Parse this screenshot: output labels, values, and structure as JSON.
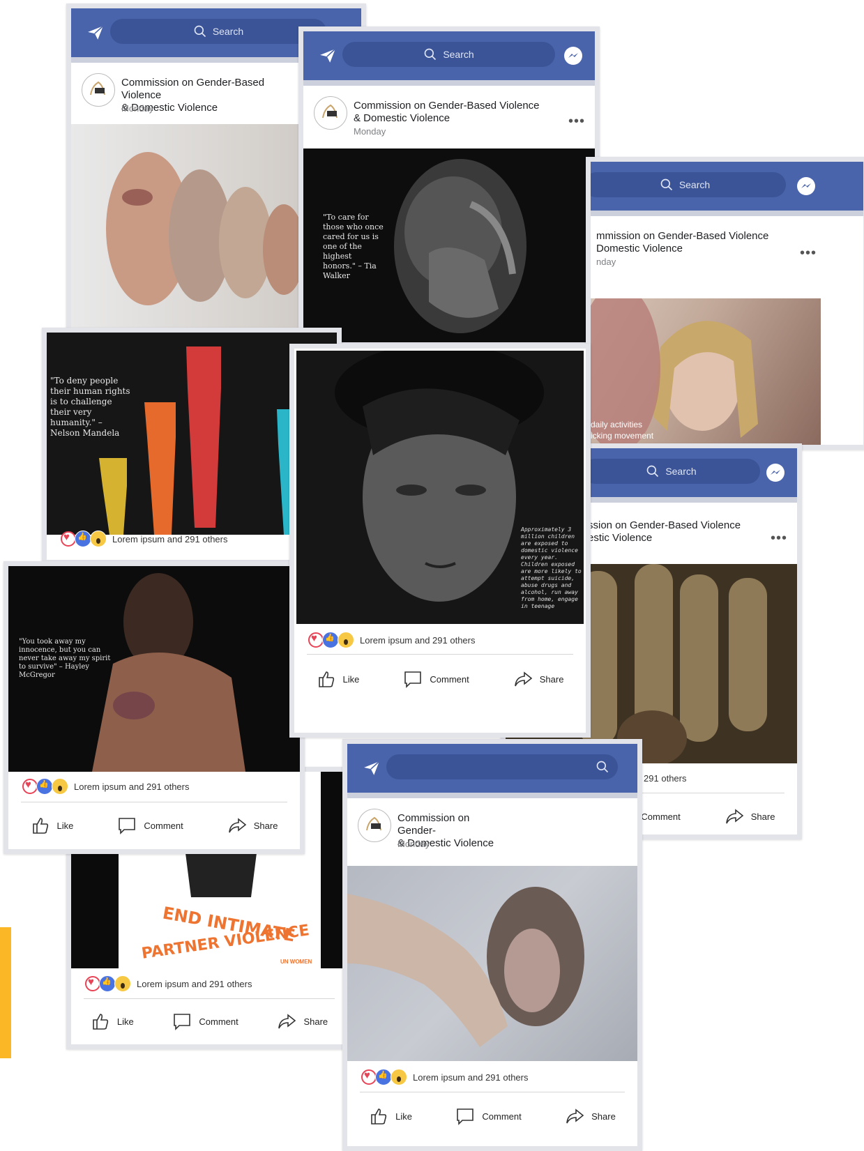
{
  "ui": {
    "search_placeholder": "Search",
    "page_name": "Commission on Gender-Based Violence & Domestic Violence",
    "page_name_line1": "Commission on Gender-Based Violence",
    "page_name_line2": "& Domestic Violence",
    "post_time": "Monday",
    "reaction_text": "Lorem ipsum and  291 others",
    "like_label": "Like",
    "comment_label": "Comment",
    "share_label": "Share",
    "more_glyph": "•••"
  },
  "colors": {
    "brand": "#4a64ab",
    "search_bg": "#3b5497",
    "accent_bar": "#fbb726",
    "heart": "#e84356",
    "like": "#4a73e2",
    "wow": "#f7c843"
  },
  "posts": {
    "mandela_quote": "\"To deny people their human rights is to challenge their very humanity.\" – Nelson Mandela",
    "walker_quote": "\"To care for those who once cared for us is one of the highest honors.\" – Tia Walker",
    "mcgregor_quote": "\"You took away my innocence, but you can never take away my spirit to survive\" – Hayley McGregor",
    "children_stat": "Approximately 3 million children are exposed to domestic violence every year. Children exposed are more likely to attempt suicide, abuse drugs and alcohol, run away from home, engage in teenage",
    "ipv_title_line1": "END INTIMATE",
    "ipv_title_line2": "PARTNER VIOLENCE",
    "ipv_logo": "UN WOMEN",
    "woman_caption_line1": "daily activities",
    "woman_caption_line2": "icking movement",
    "partial_name_a": "mmission on Gender-Based Violence",
    "partial_name_b": "Domestic Violence",
    "partial_time_a": "nday",
    "partial_name_c": "ssion on Gender-Based Violence",
    "partial_name_d": "estic Violence",
    "partial_name_e": "Commission on Gender-"
  }
}
